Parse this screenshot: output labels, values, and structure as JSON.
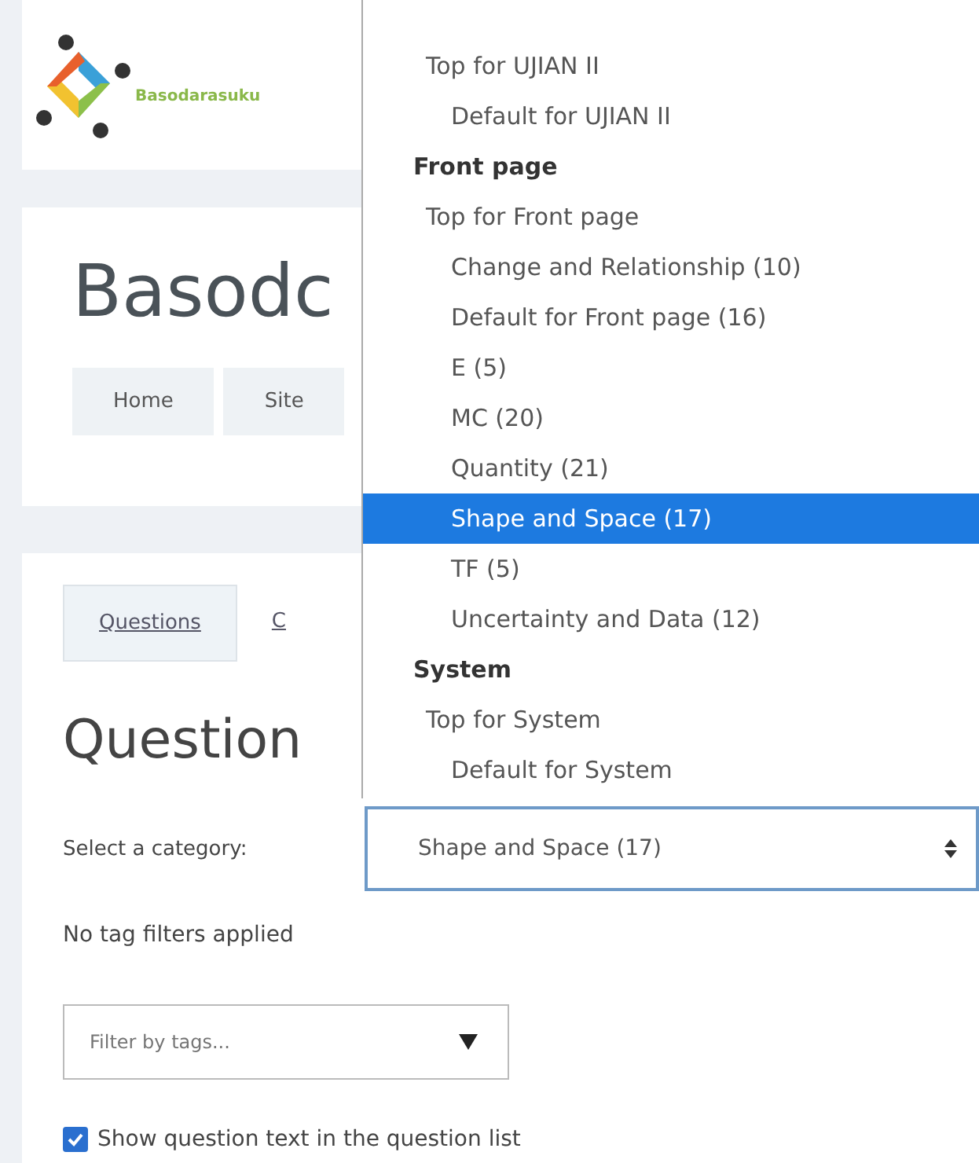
{
  "logo": {
    "name": "Basodarasuku"
  },
  "page_title": "Basodc",
  "breadcrumb": [
    "Home",
    "Site"
  ],
  "tabs": [
    {
      "label": "Questions",
      "selected": true
    },
    {
      "label": "C",
      "selected": false
    }
  ],
  "heading": "Question",
  "category": {
    "label": "Select a category:",
    "value": "Shape and Space (17)"
  },
  "tag_status": "No tag filters applied",
  "tag_filter": {
    "placeholder": "Filter by tags..."
  },
  "show_text": {
    "label": "Show question text in the question list",
    "checked": true
  },
  "dropdown": [
    {
      "options": [
        {
          "label": "Top for UJIAN II",
          "selected": false,
          "children": [
            {
              "label": "Default for UJIAN II",
              "selected": false
            }
          ]
        }
      ]
    },
    {
      "label": "Front page",
      "options": [
        {
          "label": "Top for Front page",
          "selected": false,
          "children": [
            {
              "label": "Change and Relationship (10)",
              "selected": false
            },
            {
              "label": "Default for Front page (16)",
              "selected": false
            },
            {
              "label": "E (5)",
              "selected": false
            },
            {
              "label": "MC (20)",
              "selected": false
            },
            {
              "label": "Quantity (21)",
              "selected": false
            },
            {
              "label": "Shape and Space (17)",
              "selected": true
            },
            {
              "label": "TF (5)",
              "selected": false
            },
            {
              "label": "Uncertainty and Data (12)",
              "selected": false
            }
          ]
        }
      ]
    },
    {
      "label": "System",
      "options": [
        {
          "label": "Top for System",
          "selected": false,
          "children": [
            {
              "label": "Default for System",
              "selected": false
            }
          ]
        }
      ]
    }
  ]
}
